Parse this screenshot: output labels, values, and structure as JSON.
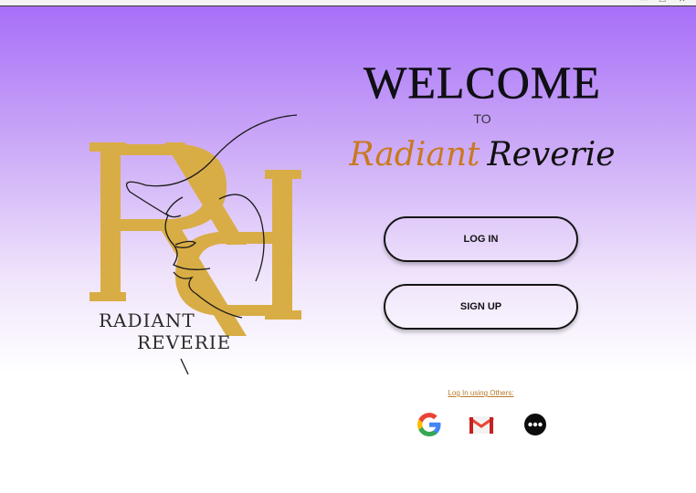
{
  "window": {
    "controls": [
      "—",
      "☐",
      "✕"
    ]
  },
  "logo": {
    "line1": "RADIANT",
    "line2": "REVERIE",
    "gold": "#d9ad45"
  },
  "welcome": {
    "title": "WELCOME",
    "to": "TO",
    "brand_word1": "Radiant",
    "brand_word2": "Reverie"
  },
  "buttons": {
    "login": "LOG IN",
    "signup": "SIGN UP"
  },
  "others": {
    "label": "Log In using Others:",
    "icons": [
      "google-icon",
      "gmail-icon",
      "more-options-icon"
    ]
  },
  "colors": {
    "accent_purple": "#a66cf8",
    "brand_orange": "#c9791f",
    "link": "#b67a2a"
  }
}
